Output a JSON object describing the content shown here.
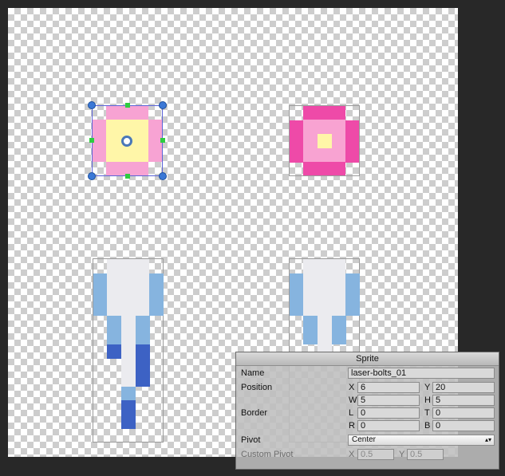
{
  "panel": {
    "title": "Sprite",
    "name_label": "Name",
    "name_value": "laser-bolts_01",
    "position_label": "Position",
    "x_label": "X",
    "x_value": "6",
    "y_label": "Y",
    "y_value": "20",
    "w_label": "W",
    "w_value": "5",
    "h_label": "H",
    "h_value": "5",
    "border_label": "Border",
    "l_label": "L",
    "l_value": "0",
    "t_label": "T",
    "t_value": "0",
    "r_label": "R",
    "r_value": "0",
    "b_label": "B",
    "b_value": "0",
    "pivot_label": "Pivot",
    "pivot_value": "Center",
    "custom_pivot_label": "Custom Pivot",
    "cp_x_label": "X",
    "cp_x_value": "0.5",
    "cp_y_label": "Y",
    "cp_y_value": "0.5"
  },
  "icons": {
    "dropdown": "up-down-arrows-icon"
  }
}
